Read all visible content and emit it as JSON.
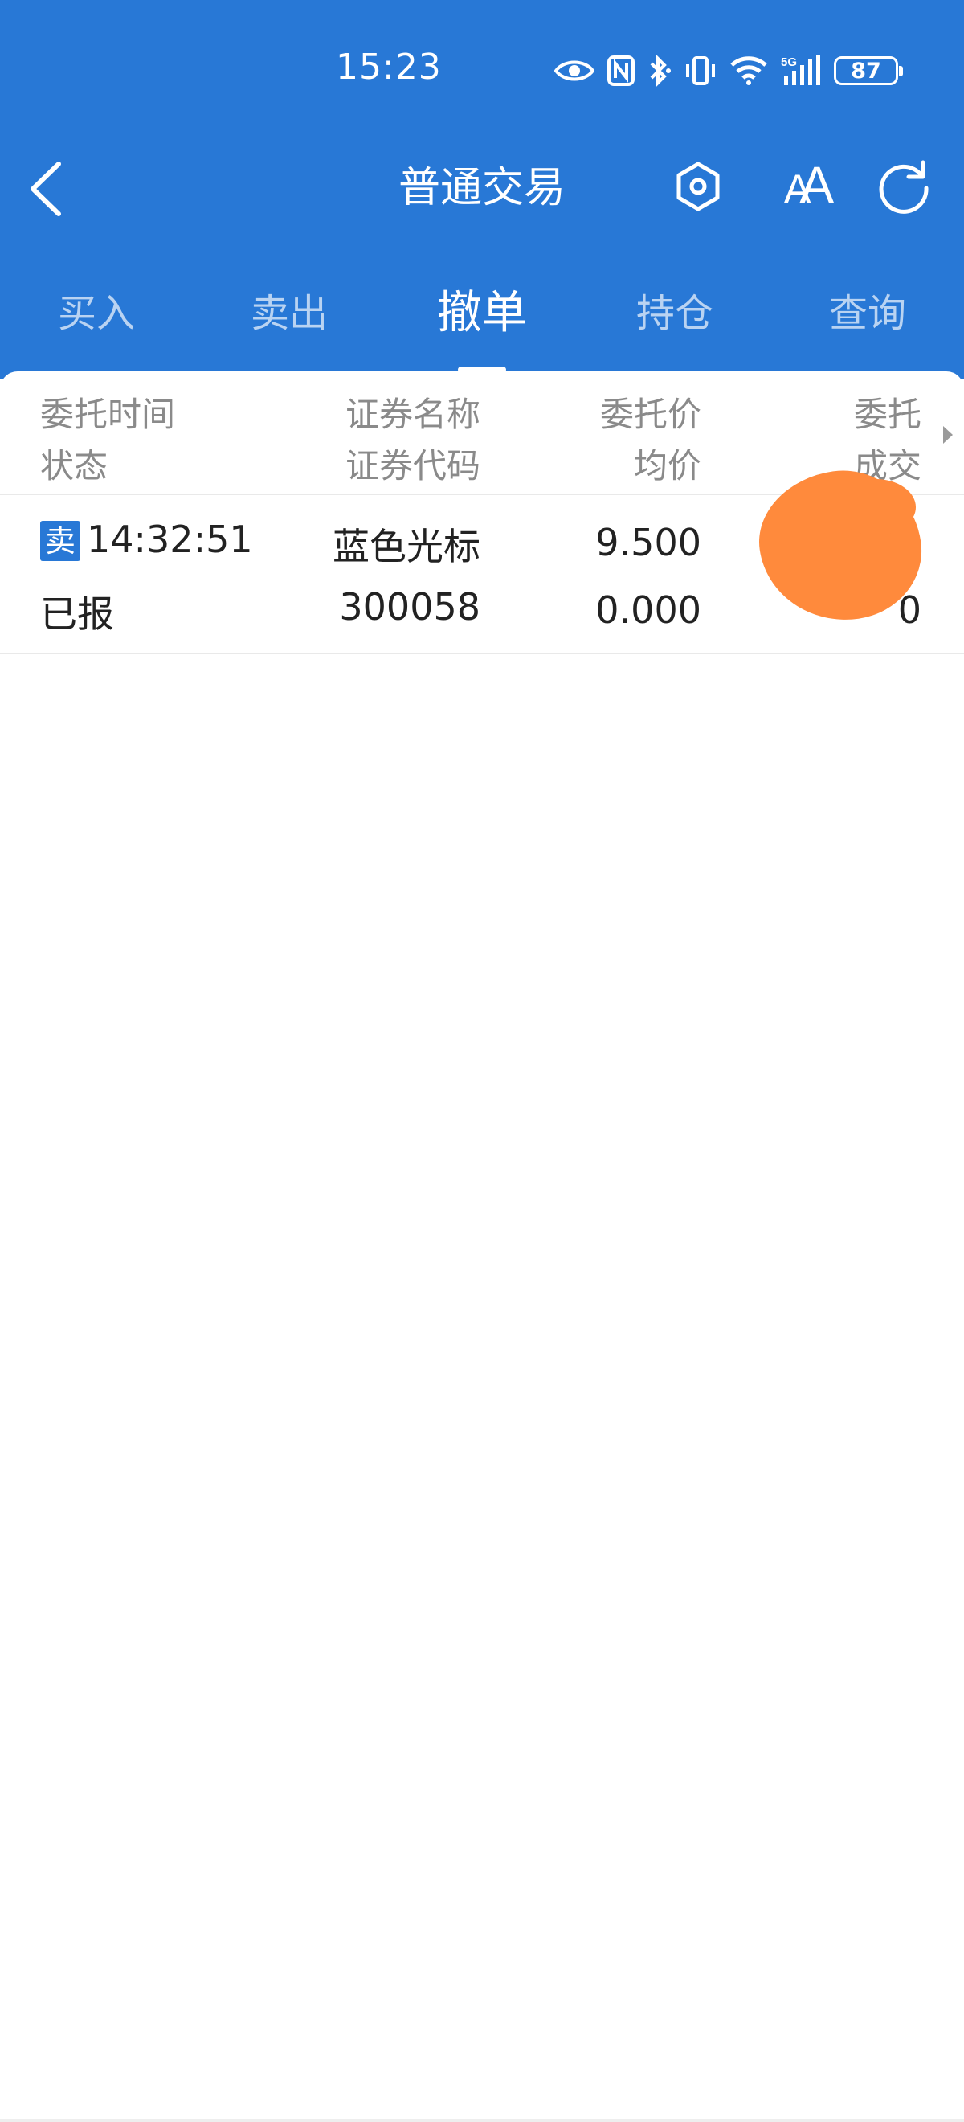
{
  "status_bar": {
    "time": "15:23",
    "battery": "87",
    "network": "5G"
  },
  "header": {
    "title": "普通交易"
  },
  "tabs": [
    {
      "label": "买入",
      "active": false
    },
    {
      "label": "卖出",
      "active": false
    },
    {
      "label": "撤单",
      "active": true
    },
    {
      "label": "持仓",
      "active": false
    },
    {
      "label": "查询",
      "active": false
    }
  ],
  "table": {
    "columns": [
      {
        "top": "委托时间",
        "bottom": "状态"
      },
      {
        "top": "证券名称",
        "bottom": "证券代码"
      },
      {
        "top": "委托价",
        "bottom": "均价"
      },
      {
        "top": "委托",
        "bottom": "成交"
      }
    ],
    "rows": [
      {
        "side": "卖",
        "time": "14:32:51",
        "status": "已报",
        "name": "蓝色光标",
        "code": "300058",
        "price": "9.500",
        "avg_price": "0.000",
        "qty_visible_fragment": "0"
      }
    ]
  },
  "colors": {
    "header_bg": "#2878d6",
    "redaction": "#ff8a3c"
  }
}
